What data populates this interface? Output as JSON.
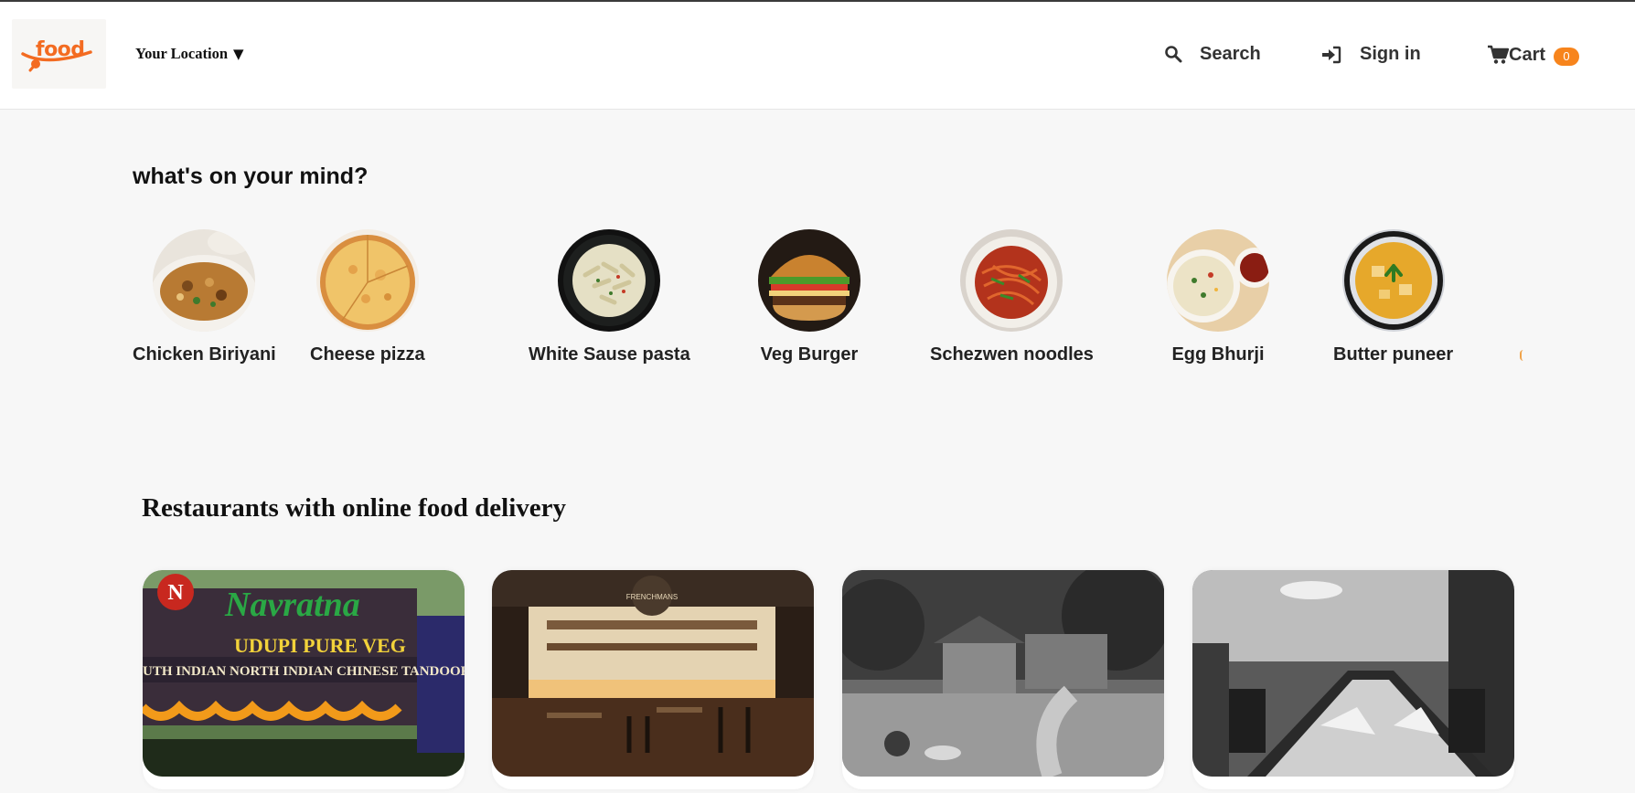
{
  "header": {
    "logo_text": "food",
    "location_label": "Your Location",
    "location_caret": "▼",
    "search_label": "Search",
    "signin_label": "Sign in",
    "cart_label": "Cart",
    "cart_count": "0"
  },
  "mind": {
    "title": "what's on your mind?",
    "items": [
      {
        "label": "Chicken Biriyani",
        "icon": "biryani-image"
      },
      {
        "label": "Cheese pizza",
        "icon": "pizza-image"
      },
      {
        "label": "White Sause pasta",
        "icon": "pasta-image"
      },
      {
        "label": "Veg Burger",
        "icon": "burger-image"
      },
      {
        "label": "Schezwen noodles",
        "icon": "noodles-image"
      },
      {
        "label": "Egg Bhurji",
        "icon": "egg-bhurji-image"
      },
      {
        "label": "Butter puneer",
        "icon": "paneer-image"
      }
    ]
  },
  "restaurants": {
    "title": "Restaurants with online food delivery",
    "cards": [
      {
        "photo": "navratna-storefront-photo",
        "sign_main": "Navratna",
        "sign_sub": "UDUPI PURE VEG",
        "sign_line": "UTH INDIAN  NORTH INDIAN  CHINESE  TANDOOR",
        "logo_letter": "N"
      },
      {
        "photo": "restaurant-interior-photo",
        "sign_main": "FRENCHMANS"
      },
      {
        "photo": "garden-restaurant-photo"
      },
      {
        "photo": "dining-hall-photo"
      }
    ]
  },
  "colors": {
    "brand": "#f36b21",
    "badge": "#f7841c",
    "background": "#f7f7f7"
  }
}
